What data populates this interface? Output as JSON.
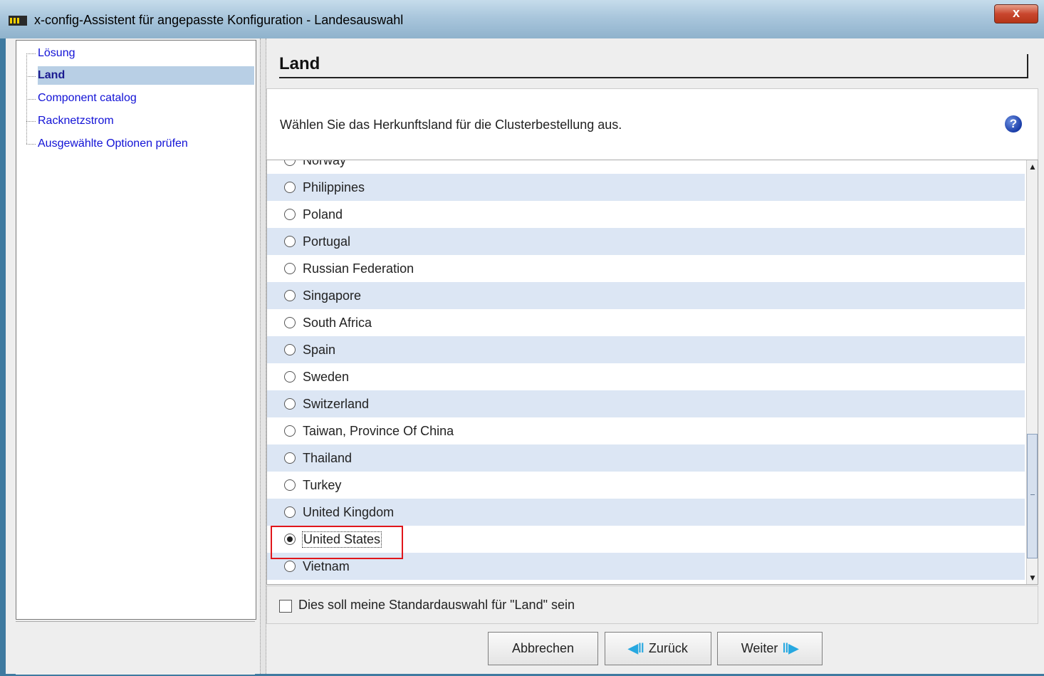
{
  "window": {
    "title": "x-config-Assistent für angepasste Konfiguration - Landesauswahl",
    "close_label": "x"
  },
  "tree": {
    "items": [
      {
        "label": "Lösung",
        "selected": false
      },
      {
        "label": "Land",
        "selected": true
      },
      {
        "label": "Component catalog",
        "selected": false
      },
      {
        "label": "Racknetzstrom",
        "selected": false
      },
      {
        "label": "Ausgewählte Optionen prüfen",
        "selected": false
      }
    ]
  },
  "header": {
    "title": "Land"
  },
  "description": {
    "text": "Wählen Sie das Herkunftsland für die Clusterbestellung aus.",
    "help_icon": "question-circle-icon"
  },
  "countries": {
    "items": [
      {
        "label": "Norway",
        "selected": false
      },
      {
        "label": "Philippines",
        "selected": false
      },
      {
        "label": "Poland",
        "selected": false
      },
      {
        "label": "Portugal",
        "selected": false
      },
      {
        "label": "Russian Federation",
        "selected": false
      },
      {
        "label": "Singapore",
        "selected": false
      },
      {
        "label": "South Africa",
        "selected": false
      },
      {
        "label": "Spain",
        "selected": false
      },
      {
        "label": "Sweden",
        "selected": false
      },
      {
        "label": "Switzerland",
        "selected": false
      },
      {
        "label": "Taiwan, Province Of China",
        "selected": false
      },
      {
        "label": "Thailand",
        "selected": false
      },
      {
        "label": "Turkey",
        "selected": false
      },
      {
        "label": "United Kingdom",
        "selected": false
      },
      {
        "label": "United States",
        "selected": true
      },
      {
        "label": "Vietnam",
        "selected": false
      }
    ]
  },
  "default_option": {
    "label": "Dies soll meine Standardauswahl für \"Land\" sein",
    "checked": false
  },
  "buttons": {
    "cancel": "Abbrechen",
    "back": "Zurück",
    "next": "Weiter"
  },
  "colors": {
    "highlight": "#e0161b",
    "tree_link": "#1212d6",
    "row_shade": "#dce6f4"
  }
}
